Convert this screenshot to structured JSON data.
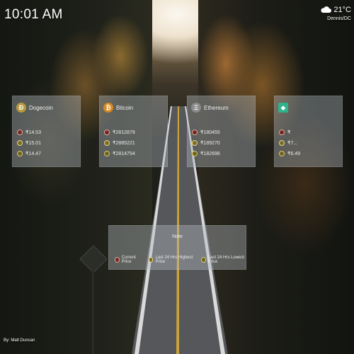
{
  "clock": {
    "time": "10:01 AM"
  },
  "weather": {
    "temperature": "21°C",
    "location": "Dennis/DC",
    "icon": "cloud-icon"
  },
  "cards": [
    {
      "coin": "Dogecoin",
      "symbol": "Ð",
      "color": "#b89a3e",
      "current": "₹14.53",
      "high": "₹15.01",
      "low": "₹14.47"
    },
    {
      "coin": "Bitcoin",
      "symbol": "₿",
      "color": "#d9891e",
      "current": "₹2812879",
      "high": "₹2885221",
      "low": "₹2814754"
    },
    {
      "coin": "Ethereum",
      "symbol": "Ξ",
      "color": "#8c8c8c",
      "current": "₹180455",
      "high": "₹189270",
      "low": "₹182696"
    },
    {
      "coin": "",
      "symbol": "◆",
      "color": "#2fb38c",
      "current": "₹",
      "high": "₹7...",
      "low": "₹6.49"
    }
  ],
  "note": {
    "title": "Note",
    "legend": [
      {
        "label": "Current Price",
        "kind": "cur"
      },
      {
        "label": "Last 24 Hrs Highest Price",
        "kind": "hi"
      },
      {
        "label": "Last 24 Hrs Lowest Price",
        "kind": "lo"
      }
    ]
  },
  "credit": "By: Matt Duncan"
}
